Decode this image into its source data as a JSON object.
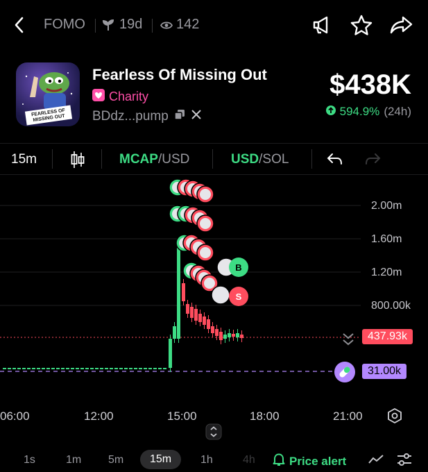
{
  "topbar": {
    "ticker": "FOMO",
    "age": "19d",
    "views": "142"
  },
  "token": {
    "name": "Fearless Of Missing Out",
    "badge": "Charity",
    "address": "BDdz...pump",
    "price": "$438K",
    "change": "594.9%",
    "change_period": "(24h)",
    "logo_text": "FEARLESS OF MISSING OUT"
  },
  "chart_toolbar": {
    "interval": "15m",
    "mcap_strong": "MCAP",
    "mcap_rest": "/USD",
    "usd_strong": "USD",
    "usd_rest": "/SOL"
  },
  "chart_data": {
    "type": "candlestick",
    "y_ticks": [
      "2.00m",
      "1.60m",
      "1.20m",
      "800.00k"
    ],
    "x_ticks": [
      "06:00",
      "12:00",
      "15:00",
      "18:00",
      "21:00"
    ],
    "current_price_label": "437.93k",
    "marked_price_label": "31.00k",
    "trade_markers": [
      "B",
      "S"
    ],
    "colors": {
      "up": "#3ddc84",
      "down": "#ff4d5e",
      "marked": "#b388ff"
    }
  },
  "timeframes": [
    "1s",
    "1m",
    "5m",
    "15m",
    "1h",
    "4h"
  ],
  "active_timeframe": "15m",
  "price_alert_label": "Price alert"
}
